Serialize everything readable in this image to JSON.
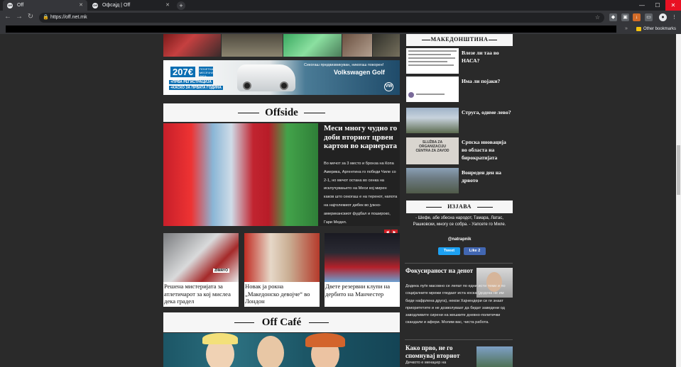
{
  "browser": {
    "tabs": [
      {
        "label": "Off",
        "favicon": "Off",
        "active": true
      },
      {
        "label": "Офсајд | Off",
        "favicon": "Off",
        "active": false
      }
    ],
    "new_tab": "+",
    "url": "https://off.net.mk",
    "bookmarks_other": "Other bookmarks",
    "bookmarks_chevron": "»",
    "controls": {
      "minimize": "—",
      "maximize": "☐",
      "close": "✕"
    },
    "nav": {
      "back": "←",
      "forward": "→",
      "reload": "↻"
    }
  },
  "ad": {
    "price": "207€",
    "price_sub": "ПОЧЕТНА МЕСЕЧНА РАТА",
    "line1": "+ПРВА РЕГИСТРАЦИЈА",
    "line2": "+КАСКО ЗА ПРВАТА ГОДИНА",
    "tagline": "Секогаш предвизвикуван, никогаш покорен!",
    "model": "Volkswagen Golf",
    "logo": "VW"
  },
  "offside": {
    "heading": "Offside",
    "hero": {
      "title": "Меси многу чудно го доби вториот црвен картон во кариерата",
      "text": "Во мечот за 3 место и бронза на Копа Америка, Аргентина го победи Чиле со 2-1, но мечот остана во сенка на исклучувањето на Меси кој мирен каков што секогаш е на теренот, напота на најголемиот дибек во јужно-американскиот фудбал и пошироко, Гари Медел.",
      "prev": "◀",
      "next": "▶"
    },
    "cards": [
      {
        "title": "Решена мистеријата за атлетичарот за кој мислеа дека градел",
        "bib": "ZIMAYO"
      },
      {
        "title": "Новак ја рокна „Македонско девојче“ во Лондон"
      },
      {
        "title": "Двете резервни клупи на дербито на Манчестер"
      }
    ]
  },
  "offcafe": {
    "heading": "Off Café"
  },
  "sidebar": {
    "makedonshtina": {
      "heading": "МАКЕДОНШТИНА",
      "items": [
        {
          "title": "Влезе ли таа во НАСА?"
        },
        {
          "title": "Има ли појаки?"
        },
        {
          "title": "Струга, одиме лево?"
        },
        {
          "title": "Српска иновација во областа на бирократијата",
          "sign": "SLUŽBA ZA ORGANIZACIJU CENTRA ZA ZAVOD"
        },
        {
          "title": "Вонреден ден на дрвото"
        }
      ]
    },
    "izjava": {
      "heading": "ИЗЈАВА",
      "quote": "- Шефе, абе збесна народот, Тамара, Латас, Рашковски, многу се собра. - Уапсете го Миле.",
      "handle": "@natrapnik",
      "tweet": "Tweet",
      "like": "Like 2"
    },
    "features": [
      {
        "title": "Фокусираност на денот",
        "text": "Додека луѓе масовно се лепат по едни исти теми и по социјалните мрежи гледаат иста коска (додека не им биде нафрлена друга), некои Хајнендери си ги знаат приоритетите и не дозволуваат да бидат заведени од заводливите сирени на жешките дневно-политички скандали и афери. Молим вас, чиста работа."
      },
      {
        "title": "Како прво, не го спомнувај вториот",
        "text": "Дечкото е менаџер на"
      }
    ]
  }
}
